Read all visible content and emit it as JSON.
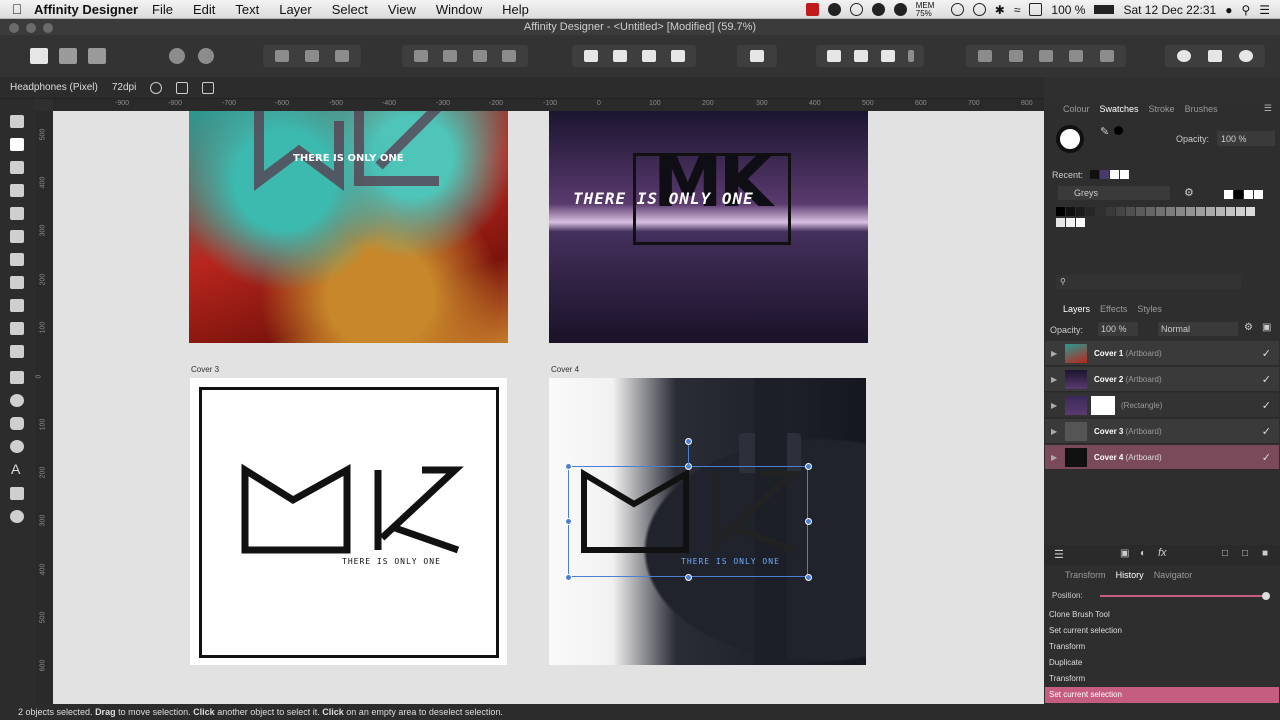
{
  "menubar": {
    "app": "Affinity Designer",
    "items": [
      "File",
      "Edit",
      "Text",
      "Layer",
      "Select",
      "View",
      "Window",
      "Help"
    ],
    "mem": "MEM 75%",
    "battery": "100 %",
    "datetime": "Sat 12 Dec  22:31"
  },
  "window": {
    "title": "Affinity Designer - <Untitled> [Modified] (59.7%)"
  },
  "context": {
    "selection": "Headphones (Pixel)",
    "dpi": "72dpi"
  },
  "ruler": {
    "top": [
      "-900",
      "-800",
      "-700",
      "-600",
      "-500",
      "-400",
      "-300",
      "-200",
      "-100",
      "0",
      "100",
      "200",
      "300",
      "400",
      "500",
      "600",
      "700",
      "800",
      "900"
    ],
    "left": [
      "500",
      "400",
      "300",
      "200",
      "100",
      "0",
      "100",
      "200",
      "300",
      "400",
      "500",
      "600"
    ]
  },
  "artboards": {
    "cover1": {
      "text": "THERE IS ONLY ONE"
    },
    "cover2": {
      "text": "THERE IS ONLY ONE",
      "logo": "MK"
    },
    "cover3": {
      "label": "Cover 3",
      "text": "THERE IS ONLY ONE"
    },
    "cover4": {
      "label": "Cover 4",
      "text": "THERE IS ONLY ONE"
    }
  },
  "colour_panel": {
    "tabs": [
      "Colour",
      "Swatches",
      "Stroke",
      "Brushes"
    ],
    "active": "Swatches",
    "opacity_label": "Opacity:",
    "opacity_value": "100 %",
    "recent_label": "Recent:",
    "palette": "Greys"
  },
  "layers_panel": {
    "tabs": [
      "Layers",
      "Effects",
      "Styles"
    ],
    "opacity_label": "Opacity:",
    "opacity_value": "100 %",
    "blend": "Normal",
    "items": [
      {
        "name": "Cover 1",
        "type": "(Artboard)"
      },
      {
        "name": "Cover 2",
        "type": "(Artboard)"
      },
      {
        "name": "",
        "type": "(Rectangle)"
      },
      {
        "name": "Cover 3",
        "type": "(Artboard)"
      },
      {
        "name": "Cover 4",
        "type": "(Artboard)"
      }
    ]
  },
  "history_panel": {
    "tabs": [
      "Transform",
      "History",
      "Navigator"
    ],
    "position_label": "Position:",
    "items": [
      "Clone Brush Tool",
      "Set current selection",
      "Transform",
      "Duplicate",
      "Transform",
      "Set current selection"
    ]
  },
  "status": {
    "count": "2 objects selected.",
    "k1": "Drag",
    "t1": "to move selection.",
    "k2": "Click",
    "t2": "another object to select it.",
    "k3": "Click",
    "t3": "on an empty area to deselect selection."
  },
  "colors": {
    "accent": "#c45d7f",
    "selection_layer": "#7a4a5a",
    "selection_handle": "#4a7fd4"
  }
}
